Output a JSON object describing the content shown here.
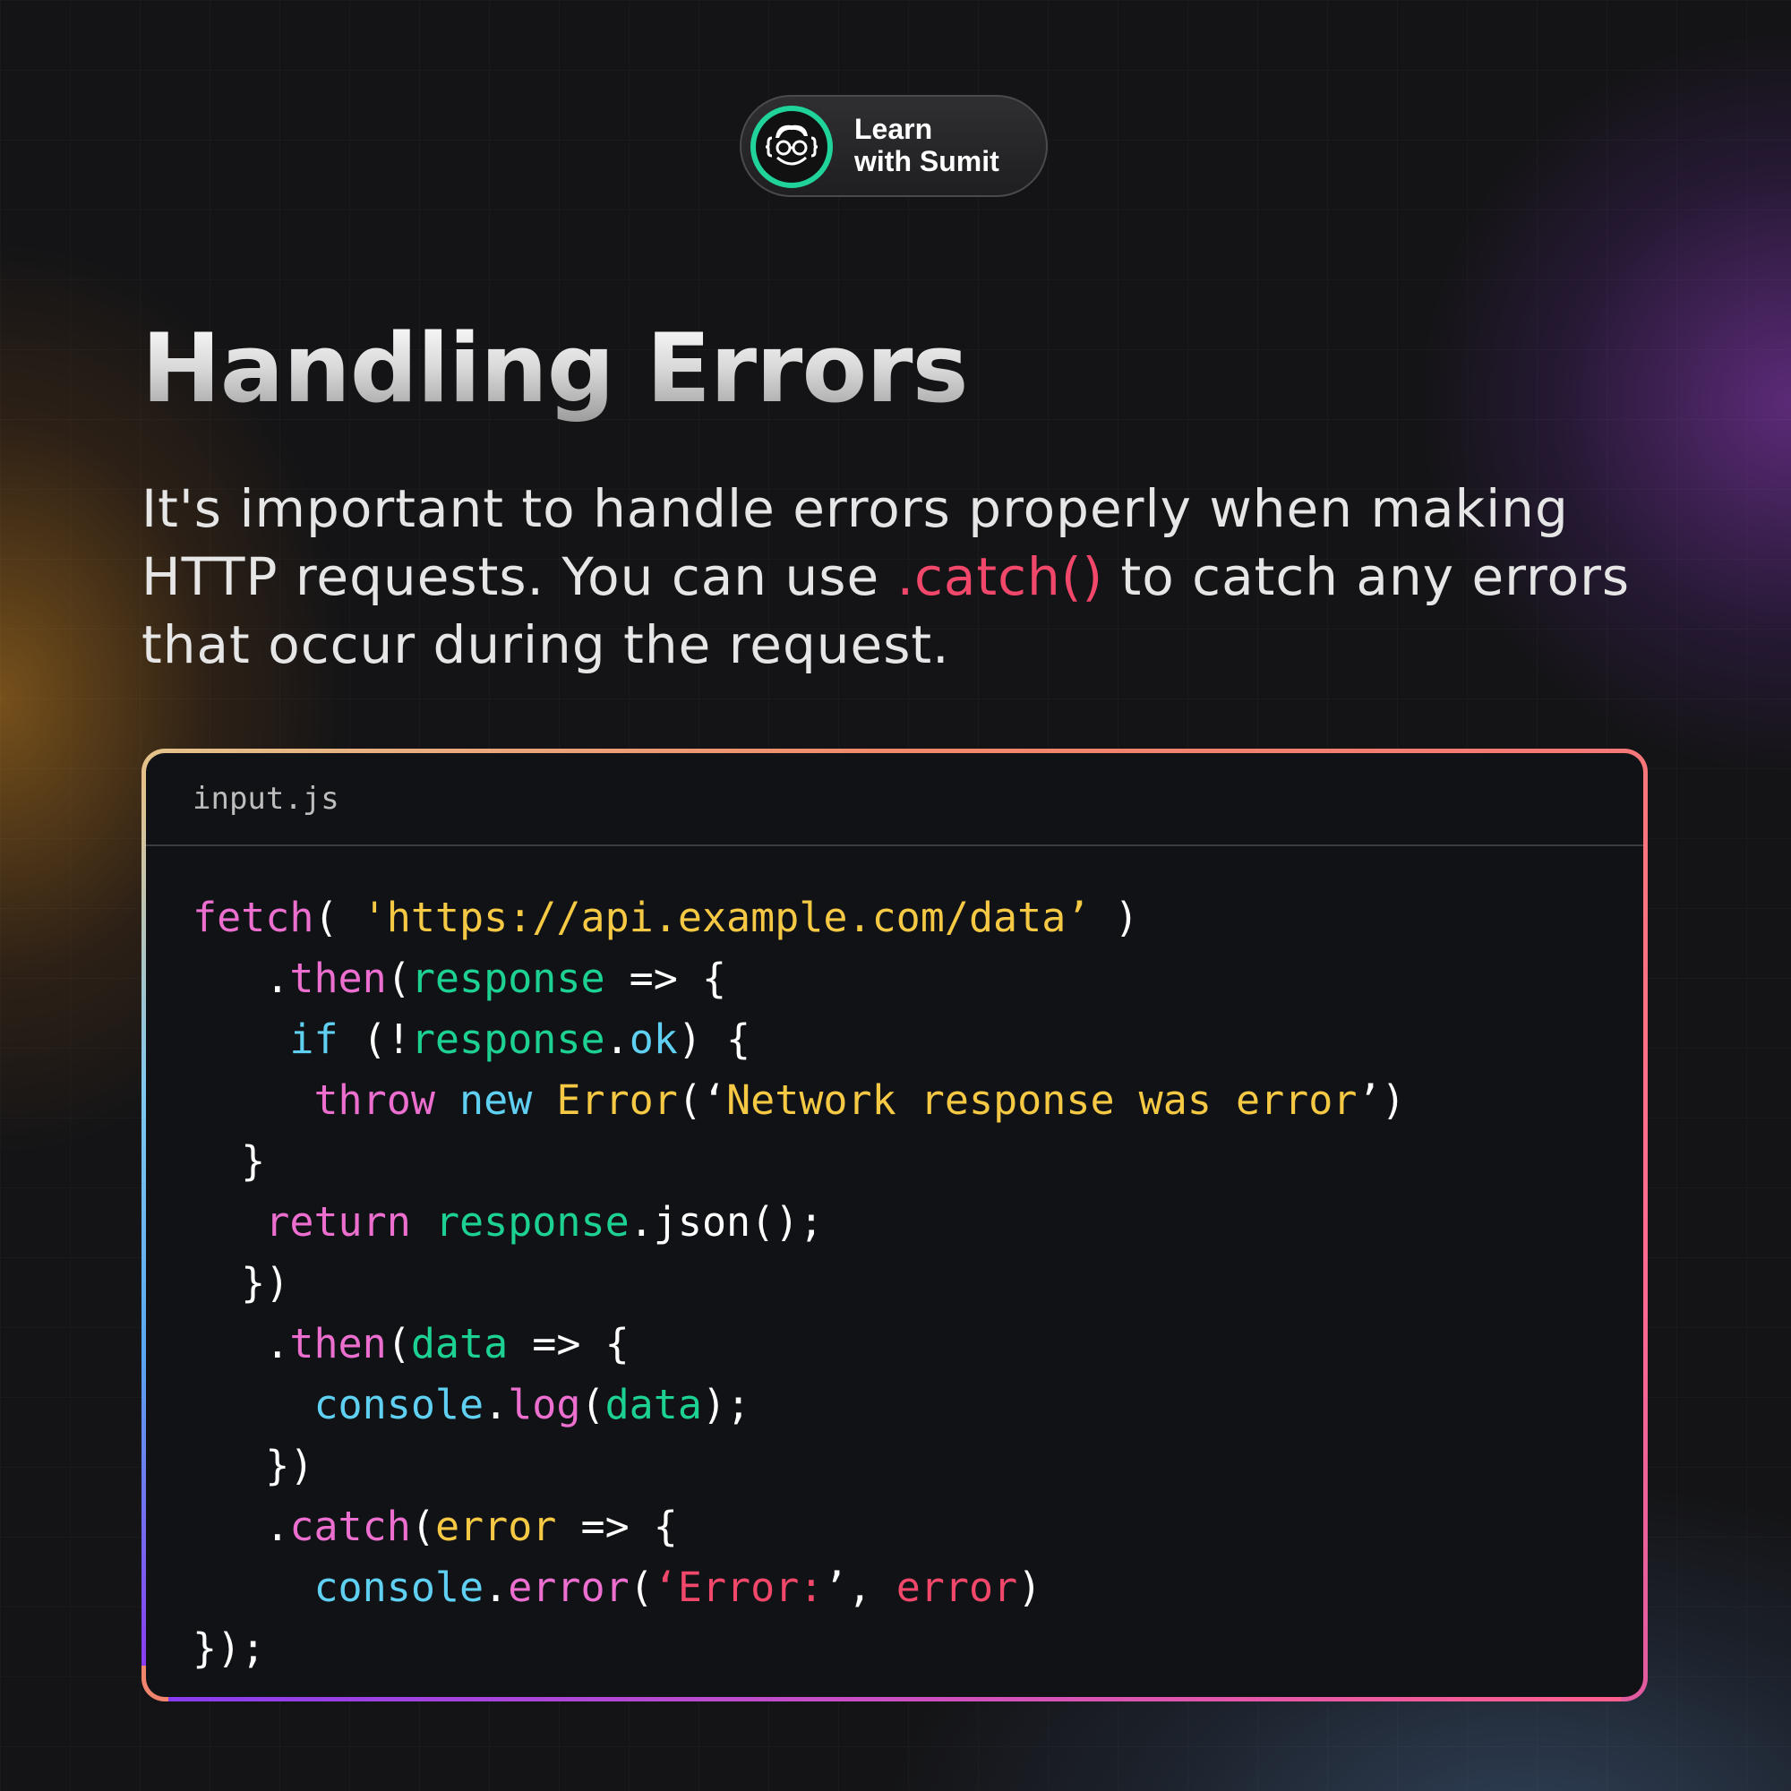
{
  "brand": {
    "line1": "Learn",
    "line2": "with Sumit",
    "accent_color": "#1fd39a",
    "icon": "coder-avatar-icon"
  },
  "title": "Handling Errors",
  "description": {
    "line1": "It's important to handle errors properly when making",
    "line2_before": "HTTP requests. You can use ",
    "line2_highlight": ".catch()",
    "line2_after": " to catch any errors",
    "line3": "that occur during the request."
  },
  "code_card": {
    "filename": "input.js",
    "lines": [
      [
        {
          "t": "fetch",
          "c": "pink"
        },
        {
          "t": "( ",
          "c": "white"
        },
        {
          "t": "'https://api.example.com/data’",
          "c": "yellow"
        },
        {
          "t": " )",
          "c": "white"
        }
      ],
      [
        {
          "t": "   .",
          "c": "white"
        },
        {
          "t": "then",
          "c": "pink"
        },
        {
          "t": "(",
          "c": "white"
        },
        {
          "t": "response",
          "c": "green"
        },
        {
          "t": " => {",
          "c": "white"
        }
      ],
      [
        {
          "t": "    ",
          "c": "white"
        },
        {
          "t": "if",
          "c": "cyan"
        },
        {
          "t": " (!",
          "c": "white"
        },
        {
          "t": "response",
          "c": "green"
        },
        {
          "t": ".",
          "c": "white"
        },
        {
          "t": "ok",
          "c": "cyan"
        },
        {
          "t": ") {",
          "c": "white"
        }
      ],
      [
        {
          "t": "     ",
          "c": "white"
        },
        {
          "t": "throw",
          "c": "pink"
        },
        {
          "t": " ",
          "c": "white"
        },
        {
          "t": "new",
          "c": "cyan"
        },
        {
          "t": " ",
          "c": "white"
        },
        {
          "t": "Error",
          "c": "yellow"
        },
        {
          "t": "(‘",
          "c": "white"
        },
        {
          "t": "Network response was error",
          "c": "yellow"
        },
        {
          "t": "’)",
          "c": "white"
        }
      ],
      [
        {
          "t": "  }",
          "c": "white"
        }
      ],
      [
        {
          "t": "   ",
          "c": "white"
        },
        {
          "t": "return",
          "c": "pink"
        },
        {
          "t": " ",
          "c": "white"
        },
        {
          "t": "response",
          "c": "green"
        },
        {
          "t": ".json();",
          "c": "white"
        }
      ],
      [
        {
          "t": "  })",
          "c": "white"
        }
      ],
      [
        {
          "t": "   .",
          "c": "white"
        },
        {
          "t": "then",
          "c": "pink"
        },
        {
          "t": "(",
          "c": "white"
        },
        {
          "t": "data",
          "c": "green"
        },
        {
          "t": " => {",
          "c": "white"
        }
      ],
      [
        {
          "t": "     ",
          "c": "white"
        },
        {
          "t": "console",
          "c": "cyan"
        },
        {
          "t": ".",
          "c": "white"
        },
        {
          "t": "log",
          "c": "pink"
        },
        {
          "t": "(",
          "c": "white"
        },
        {
          "t": "data",
          "c": "green"
        },
        {
          "t": ");",
          "c": "white"
        }
      ],
      [
        {
          "t": "   })",
          "c": "white"
        }
      ],
      [
        {
          "t": "   .",
          "c": "white"
        },
        {
          "t": "catch",
          "c": "pink"
        },
        {
          "t": "(",
          "c": "white"
        },
        {
          "t": "error",
          "c": "yellow"
        },
        {
          "t": " => {",
          "c": "white"
        }
      ],
      [
        {
          "t": "     ",
          "c": "white"
        },
        {
          "t": "console",
          "c": "cyan"
        },
        {
          "t": ".",
          "c": "white"
        },
        {
          "t": "error",
          "c": "pink"
        },
        {
          "t": "(",
          "c": "white"
        },
        {
          "t": "‘Error:",
          "c": "red"
        },
        {
          "t": "’, ",
          "c": "white"
        },
        {
          "t": "error",
          "c": "red"
        },
        {
          "t": ")",
          "c": "white"
        }
      ],
      [
        {
          "t": "});",
          "c": "white"
        }
      ]
    ]
  }
}
